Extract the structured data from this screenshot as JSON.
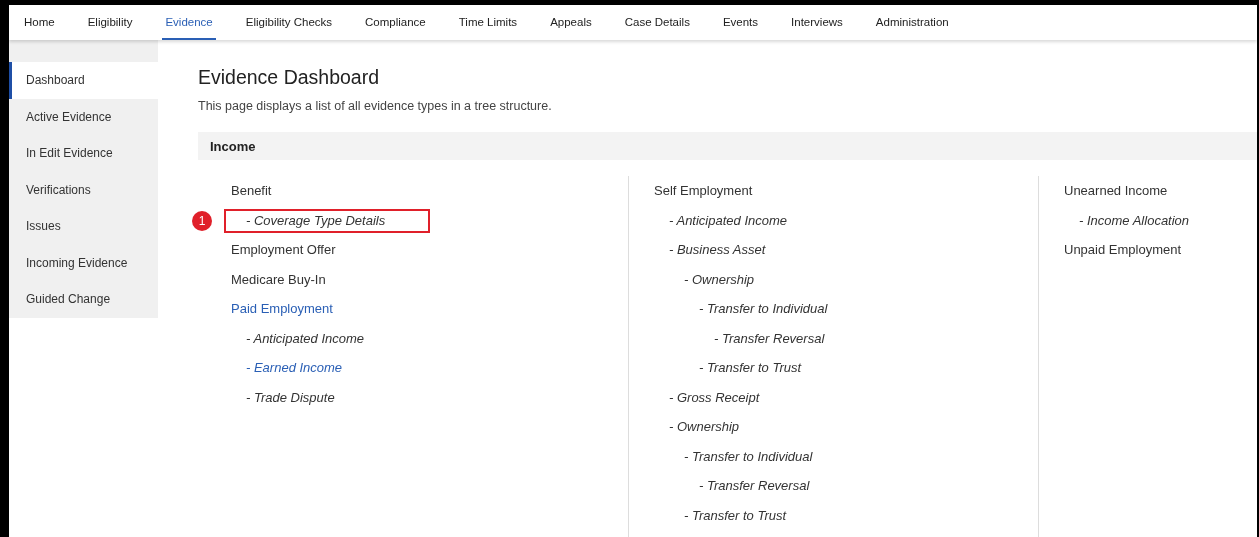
{
  "nav_tabs": [
    {
      "label": "Home",
      "selected": false
    },
    {
      "label": "Eligibility",
      "selected": false
    },
    {
      "label": "Evidence",
      "selected": true
    },
    {
      "label": "Eligibility Checks",
      "selected": false
    },
    {
      "label": "Compliance",
      "selected": false
    },
    {
      "label": "Time Limits",
      "selected": false
    },
    {
      "label": "Appeals",
      "selected": false
    },
    {
      "label": "Case Details",
      "selected": false
    },
    {
      "label": "Events",
      "selected": false
    },
    {
      "label": "Interviews",
      "selected": false
    },
    {
      "label": "Administration",
      "selected": false
    }
  ],
  "sidebar": {
    "items": [
      {
        "label": "Dashboard",
        "selected": true
      },
      {
        "label": "Active Evidence",
        "selected": false
      },
      {
        "label": "In Edit Evidence",
        "selected": false
      },
      {
        "label": "Verifications",
        "selected": false
      },
      {
        "label": "Issues",
        "selected": false
      },
      {
        "label": "Incoming Evidence",
        "selected": false
      },
      {
        "label": "Guided Change",
        "selected": false
      }
    ]
  },
  "page": {
    "title": "Evidence Dashboard",
    "description": "This page displays a list of all evidence types in a tree structure."
  },
  "income": {
    "heading": "Income",
    "columns": [
      {
        "items": [
          {
            "label": "Benefit",
            "link": false,
            "children": [
              {
                "label": "- Coverage Type Details",
                "link": false,
                "highlighted": true,
                "marker": "1"
              }
            ]
          },
          {
            "label": "Employment Offer",
            "link": false
          },
          {
            "label": "Medicare Buy-In",
            "link": false
          },
          {
            "label": "Paid Employment",
            "link": true,
            "children": [
              {
                "label": "- Anticipated Income",
                "link": false
              },
              {
                "label": "- Earned Income",
                "link": true
              },
              {
                "label": "- Trade Dispute",
                "link": false
              }
            ]
          }
        ]
      },
      {
        "items": [
          {
            "label": "Self Employment",
            "link": false,
            "children": [
              {
                "label": "- Anticipated Income",
                "link": false
              },
              {
                "label": "- Business Asset",
                "link": false,
                "children": [
                  {
                    "label": "- Ownership",
                    "link": false,
                    "children": [
                      {
                        "label": "- Transfer to Individual",
                        "link": false,
                        "children": [
                          {
                            "label": "- Transfer Reversal",
                            "link": false
                          }
                        ]
                      },
                      {
                        "label": "- Transfer to Trust",
                        "link": false
                      }
                    ]
                  }
                ]
              },
              {
                "label": "- Gross Receipt",
                "link": false
              },
              {
                "label": "- Ownership",
                "link": false,
                "children": [
                  {
                    "label": "- Transfer to Individual",
                    "link": false,
                    "children": [
                      {
                        "label": "- Transfer Reversal",
                        "link": false
                      }
                    ]
                  },
                  {
                    "label": "- Transfer to Trust",
                    "link": false
                  }
                ]
              }
            ]
          }
        ]
      },
      {
        "items": [
          {
            "label": "Unearned Income",
            "link": false,
            "children": [
              {
                "label": "- Income Allocation",
                "link": false
              }
            ]
          },
          {
            "label": "Unpaid Employment",
            "link": false
          }
        ]
      }
    ]
  }
}
